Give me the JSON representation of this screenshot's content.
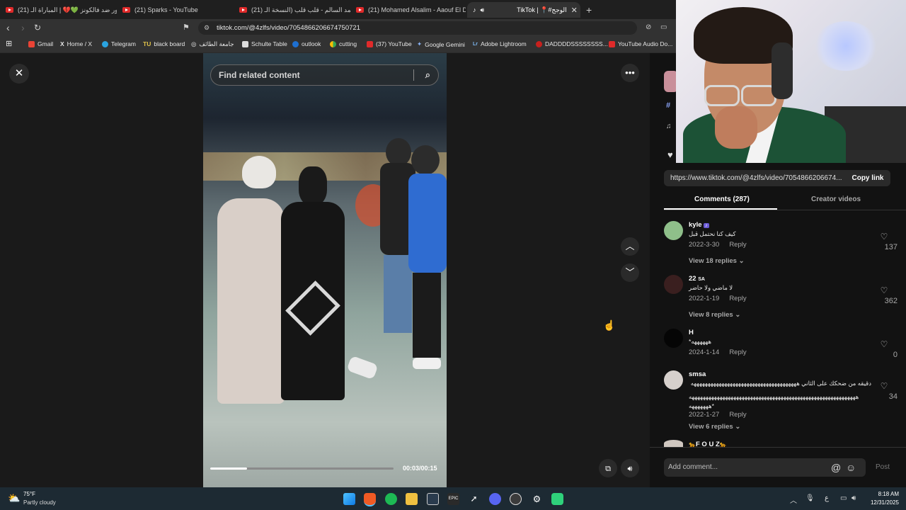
{
  "browser": {
    "tabs": [
      {
        "label": "(21) باور ضد فالكونز 💚💔 | المباراة الـ"
      },
      {
        "label": "(21) Sparks - YouTube"
      },
      {
        "label": "(21) محمد السالم - قلب قلب (النسخة الـ"
      },
      {
        "label": "(21) Mohamed Alsalim - Aaouf El De"
      },
      {
        "label": "TikTok | 📍#الوجح"
      }
    ],
    "new_tab": "+",
    "url": "tiktok.com/@4zlfs/video/7054866206674750721",
    "bookmarks": [
      "Gmail",
      "Home / X",
      "Telegram",
      "black board",
      "جامعة الطائف",
      "Schulte Table",
      "outlook",
      "cutting",
      "(37) YouTube",
      "Google Gemini",
      "Adobe Lightroom",
      "DADDDDSSSSSSSS...",
      "YouTube Audio Do..."
    ],
    "bookmark_prefixes": [
      "",
      "X",
      "",
      "TU",
      "",
      "",
      "",
      "",
      "",
      "",
      "Lr",
      "",
      ""
    ]
  },
  "video": {
    "search_placeholder": "Find related content",
    "time": "00:03/00:15",
    "progress_fraction": 0.2
  },
  "panel": {
    "share_link": "https://www.tiktok.com/@4zlfs/video/7054866206674...",
    "copy_link": "Copy link",
    "tabs": [
      "Comments (287)",
      "Creator videos"
    ],
    "add_comment_placeholder": "Add comment...",
    "post": "Post",
    "comments": [
      {
        "user": "kyle",
        "text": "كيف كنا نحتمل قبل",
        "date": "2022-3-30",
        "reply": "Reply",
        "likes": "137",
        "view_replies": "View 18 replies"
      },
      {
        "user": "22",
        "suffix": "SA",
        "text": "لا ماضي ولا حاضر",
        "date": "2022-1-19",
        "reply": "Reply",
        "likes": "362",
        "view_replies": "View 8 replies"
      },
      {
        "user": "H",
        "text": "*ههههههه",
        "date": "2024-1-14",
        "reply": "Reply",
        "likes": "0",
        "view_replies": ""
      },
      {
        "user": "smsa",
        "text": "دقيقه من ضحكك على الثاني ههههههههههههههههههههههههههههههههههههههه",
        "text2": "ههههههههههههههههههههههههههههههههههههههههههههههههههههههههههههه",
        "text3": "هههههههه*",
        "date": "2022-1-27",
        "reply": "Reply",
        "likes": "34",
        "view_replies": "View 6 replies"
      }
    ],
    "partial_user": "F O U Z"
  },
  "taskbar": {
    "temp": "75°F",
    "weather": "Partly cloudy",
    "time": "8:18 AM",
    "date": "12/31/2025",
    "lang": "ع"
  }
}
